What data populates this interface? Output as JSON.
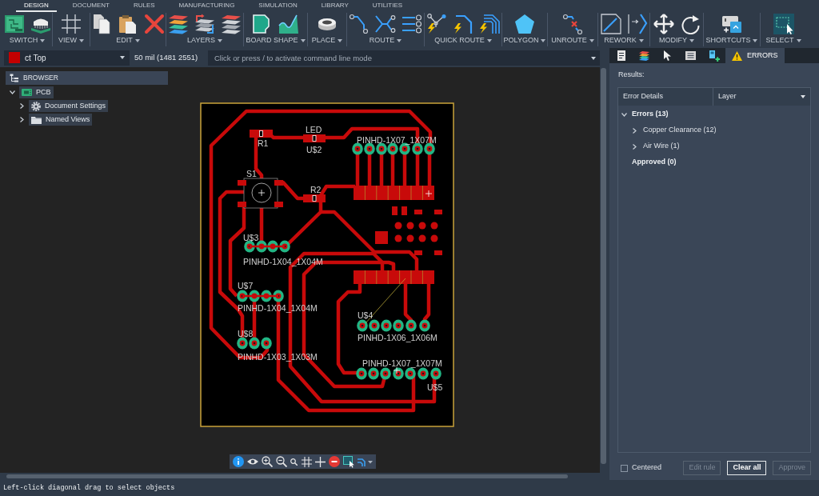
{
  "ribbon": {
    "tabs": [
      {
        "label": "DESIGN",
        "selected": true
      },
      {
        "label": "DOCUMENT",
        "selected": false
      },
      {
        "label": "RULES",
        "selected": false
      },
      {
        "label": "MANUFACTURING",
        "selected": false
      },
      {
        "label": "SIMULATION",
        "selected": false
      },
      {
        "label": "LIBRARY",
        "selected": false
      },
      {
        "label": "UTILITIES",
        "selected": false
      }
    ],
    "groups": [
      {
        "label": "SWITCH",
        "active": false
      },
      {
        "label": "VIEW",
        "active": false
      },
      {
        "label": "EDIT",
        "active": false
      },
      {
        "label": "LAYERS",
        "active": false
      },
      {
        "label": "BOARD SHAPE",
        "active": false
      },
      {
        "label": "PLACE",
        "active": false
      },
      {
        "label": "ROUTE",
        "active": false
      },
      {
        "label": "QUICK ROUTE",
        "active": false
      },
      {
        "label": "POLYGON",
        "active": false
      },
      {
        "label": "UNROUTE",
        "active": false
      },
      {
        "label": "REWORK",
        "active": false
      },
      {
        "label": "MODIFY",
        "active": false
      },
      {
        "label": "SHORTCUTS",
        "active": false
      },
      {
        "label": "SELECT",
        "active": true
      }
    ]
  },
  "command_bar": {
    "layer": "ct Top",
    "readout": "50 mil (1481 2551)",
    "command": {
      "placeholder": "Click or press / to activate command line mode"
    }
  },
  "browser": {
    "title": "BROWSER",
    "items": [
      {
        "label": "PCB",
        "kind": "board",
        "expanded": true,
        "children": [
          {
            "label": "Document Settings",
            "kind": "settings",
            "expanded": false
          },
          {
            "label": "Named Views",
            "kind": "folder",
            "expanded": false
          }
        ]
      }
    ]
  },
  "canvas": {
    "labels": [
      "R1",
      "LED",
      "U$2",
      "PINHD-1X07_1X07M",
      "S1",
      "R2",
      "U$3",
      "PINHD-1X04_1X04M",
      "U$7",
      "PINHD-1X04_1X04M",
      "U$4",
      "PINHD-1X06_1X06M",
      "U$8",
      "PINHD-1X03_1X03M",
      "PINHD-1X07_1X07M",
      "U$5"
    ]
  },
  "inspector": {
    "tabs": [
      {
        "selected": false
      },
      {
        "selected": false
      },
      {
        "selected": false
      },
      {
        "selected": false
      },
      {
        "selected": false
      },
      {
        "label": "ERRORS",
        "selected": true
      }
    ],
    "results_label": "Results:",
    "columns": [
      "Error Details",
      "Layer"
    ],
    "tree": [
      {
        "label": "Errors (13)",
        "expanded": true,
        "children": [
          {
            "label": "Copper Clearance (12)",
            "expanded": false
          },
          {
            "label": "Air Wire (1)",
            "expanded": false
          }
        ]
      },
      {
        "label": "Approved (0)"
      }
    ],
    "centered": {
      "label": "Centered",
      "checked": false
    },
    "buttons": [
      {
        "label": "Edit rule",
        "disabled": true
      },
      {
        "label": "Clear all",
        "disabled": false
      },
      {
        "label": "Approve",
        "disabled": true
      }
    ]
  },
  "status_bar": "Left-click diagonal drag to select objects"
}
